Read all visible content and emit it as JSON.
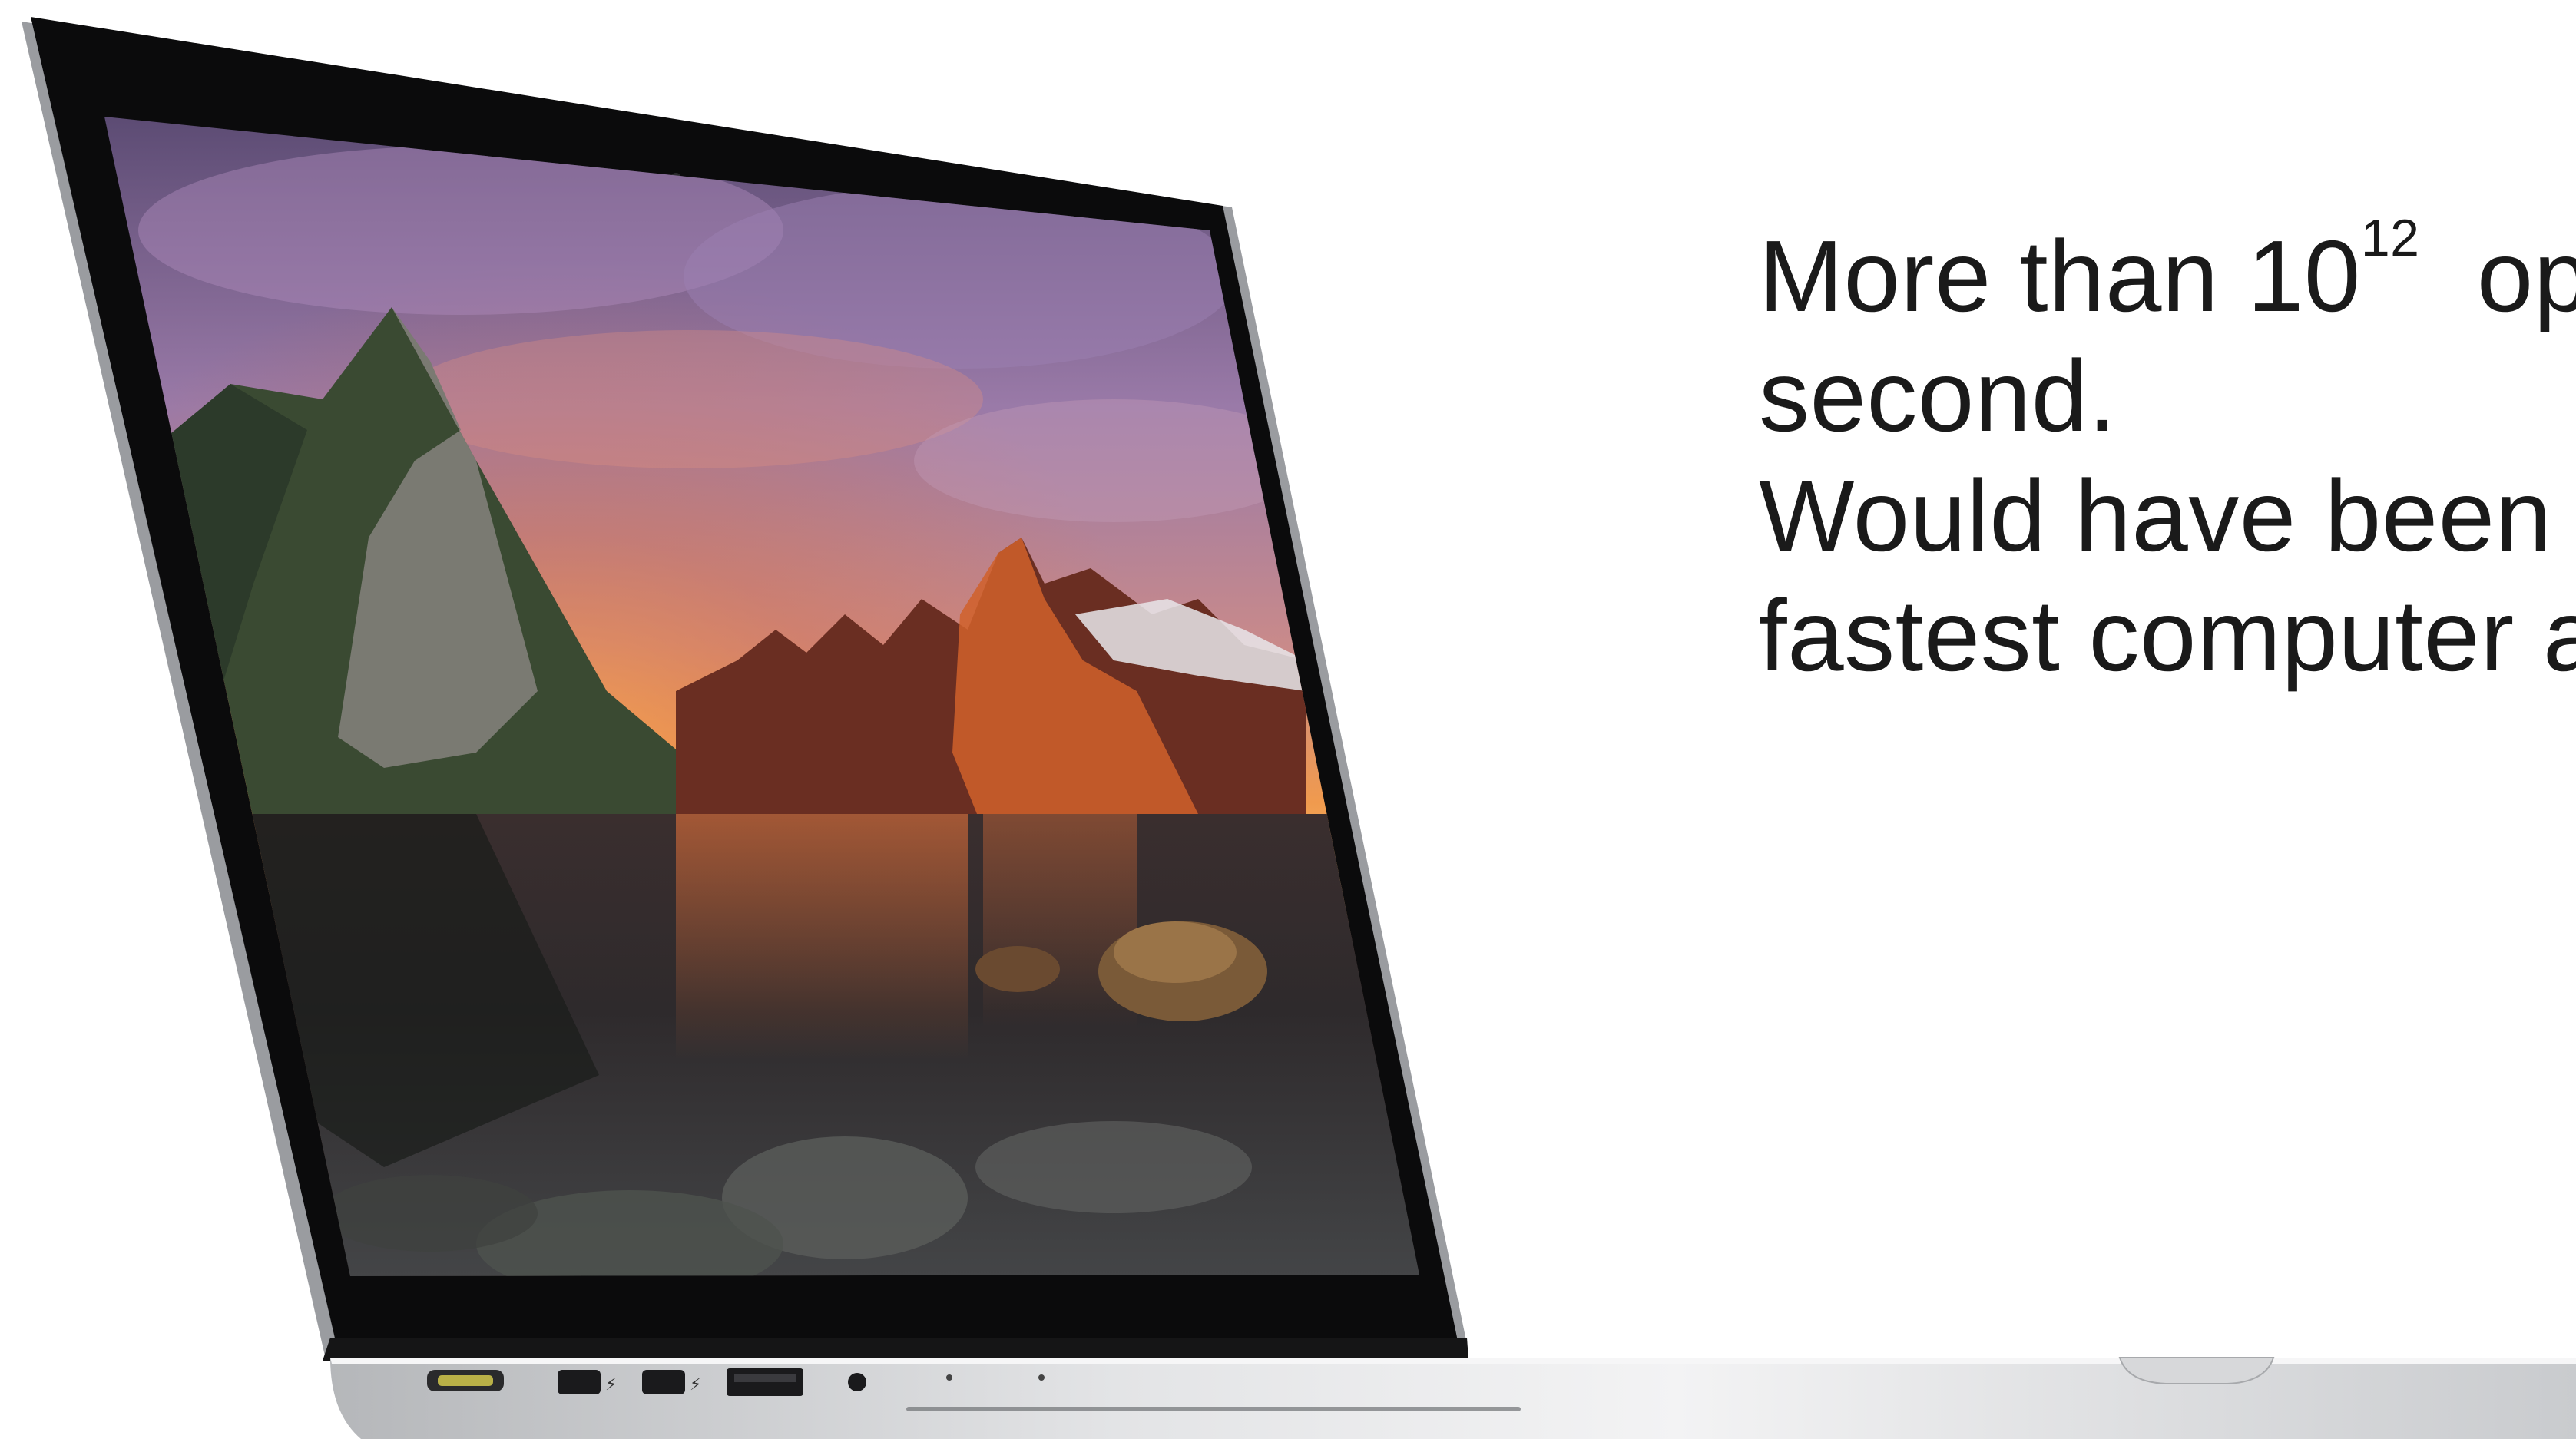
{
  "slide": {
    "line1_prefix": "More than 10",
    "line1_exponent": "12",
    "line1_suffix": "  op",
    "line2": "second.",
    "line3": "Would have been t",
    "line4": "fastest computer a"
  },
  "laptop_image": {
    "subject": "laptop-with-mountain-lake-sunset-wallpaper",
    "colors": {
      "bezel": "#0d0d0d",
      "aluminum": "#c9cbce",
      "sky_purple": "#8a6a9a",
      "sunset_orange": "#e0703a",
      "water_dark": "#2a2628",
      "background": "#ffffff"
    }
  }
}
